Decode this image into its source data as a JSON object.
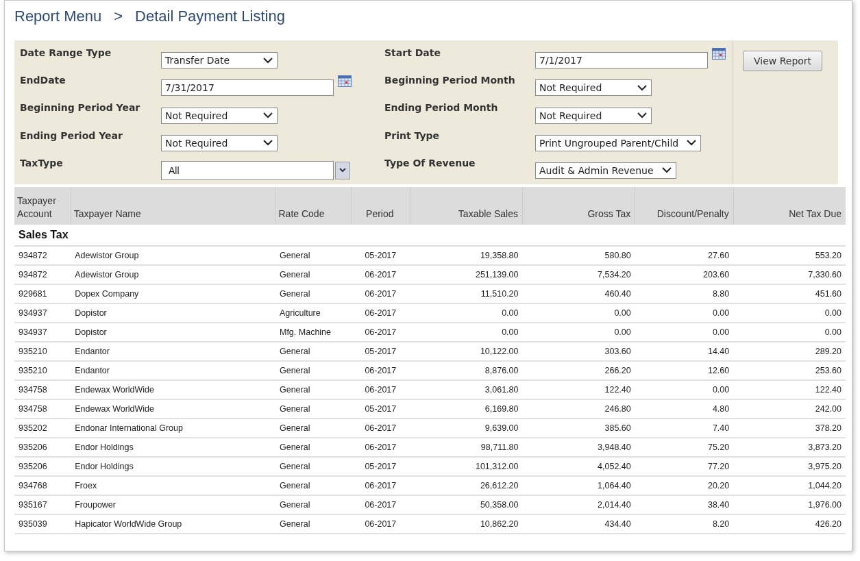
{
  "breadcrumb": {
    "parent": "Report Menu",
    "separator": ">",
    "current": "Detail Payment Listing"
  },
  "filters": {
    "left": [
      {
        "label": "Date Range Type",
        "kind": "select",
        "value": "Transfer Date"
      },
      {
        "label": "EndDate",
        "kind": "date",
        "value": "7/31/2017"
      },
      {
        "label": "Beginning Period Year",
        "kind": "select",
        "value": "Not Required"
      },
      {
        "label": "Ending Period Year",
        "kind": "select",
        "value": "Not Required"
      },
      {
        "label": "TaxType",
        "kind": "combo",
        "value": "All"
      }
    ],
    "right": [
      {
        "label": "Start Date",
        "kind": "date",
        "value": "7/1/2017"
      },
      {
        "label": "Beginning Period Month",
        "kind": "select",
        "value": "Not Required"
      },
      {
        "label": "Ending Period Month",
        "kind": "select",
        "value": "Not Required"
      },
      {
        "label": "Print Type",
        "kind": "select",
        "value": "Print Ungrouped Parent/Child"
      },
      {
        "label": "Type Of Revenue",
        "kind": "select",
        "value": "Audit & Admin Revenue"
      }
    ],
    "button": "View Report"
  },
  "table": {
    "columns": [
      "Taxpayer Account",
      "Taxpayer Name",
      "Rate Code",
      "Period",
      "Taxable Sales",
      "Gross Tax",
      "Discount/Penalty",
      "Net Tax Due"
    ],
    "group": "Sales Tax",
    "rows": [
      [
        "934872",
        "Adewistor  Group",
        "General",
        "05-2017",
        "19,358.80",
        "580.80",
        "27.60",
        "553.20"
      ],
      [
        "934872",
        "Adewistor  Group",
        "General",
        "06-2017",
        "251,139.00",
        "7,534.20",
        "203.60",
        "7,330.60"
      ],
      [
        "929681",
        "Dopex  Company",
        "General",
        "06-2017",
        "11,510.20",
        "460.40",
        "8.80",
        "451.60"
      ],
      [
        "934937",
        "Dopistor",
        "Agriculture",
        "06-2017",
        "0.00",
        "0.00",
        "0.00",
        "0.00"
      ],
      [
        "934937",
        "Dopistor",
        "Mfg. Machine",
        "06-2017",
        "0.00",
        "0.00",
        "0.00",
        "0.00"
      ],
      [
        "935210",
        "Endantor",
        "General",
        "05-2017",
        "10,122.00",
        "303.60",
        "14.40",
        "289.20"
      ],
      [
        "935210",
        "Endantor",
        "General",
        "06-2017",
        "8,876.00",
        "266.20",
        "12.60",
        "253.60"
      ],
      [
        "934758",
        "Endewax WorldWide",
        "General",
        "06-2017",
        "3,061.80",
        "122.40",
        "0.00",
        "122.40"
      ],
      [
        "934758",
        "Endewax WorldWide",
        "General",
        "05-2017",
        "6,169.80",
        "246.80",
        "4.80",
        "242.00"
      ],
      [
        "935202",
        "Endonar International Group",
        "General",
        "06-2017",
        "9,639.00",
        "385.60",
        "7.40",
        "378.20"
      ],
      [
        "935206",
        "Endor Holdings",
        "General",
        "06-2017",
        "98,711.80",
        "3,948.40",
        "75.20",
        "3,873.20"
      ],
      [
        "935206",
        "Endor Holdings",
        "General",
        "05-2017",
        "101,312.00",
        "4,052.40",
        "77.20",
        "3,975.20"
      ],
      [
        "934768",
        "Froex",
        "General",
        "06-2017",
        "26,612.20",
        "1,064.40",
        "20.20",
        "1,044.20"
      ],
      [
        "935167",
        "Froupower",
        "General",
        "06-2017",
        "50,358.00",
        "2,014.40",
        "38.40",
        "1,976.00"
      ],
      [
        "935039",
        "Hapicator WorldWide Group",
        "General",
        "06-2017",
        "10,862.20",
        "434.40",
        "8.20",
        "426.20"
      ]
    ]
  }
}
